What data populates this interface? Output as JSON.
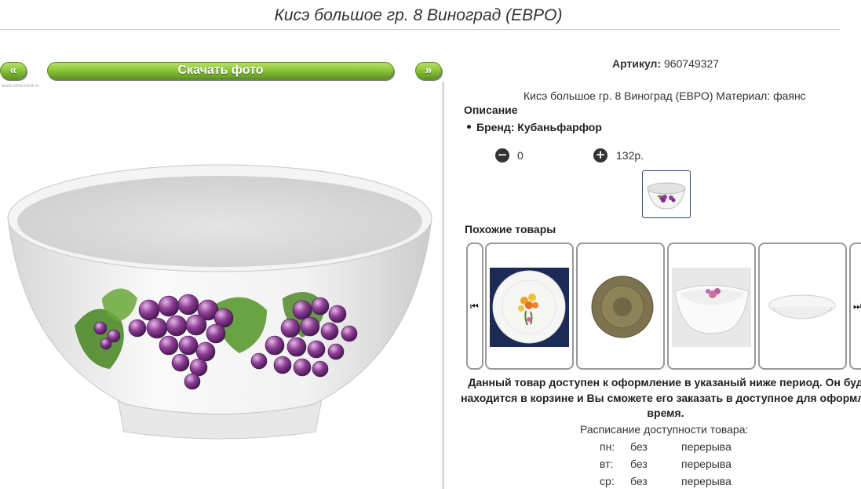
{
  "product": {
    "title": "Кисэ большое гр. 8 Виноград (ЕВРО)",
    "article_label": "Артикул:",
    "article_value": "960749327",
    "description": "Кисэ большое гр. 8 Виноград (ЕВРО) Материал: фаянс",
    "description_heading": "Описание",
    "brand": "Бренд: Кубаньфарфор",
    "quantity": "0",
    "price": "132р.",
    "watermark": "www.sima-land.ru"
  },
  "toolbar": {
    "prev_label": "«",
    "download_label": "Скачать фото",
    "next_label": "»"
  },
  "similar": {
    "heading": "Похожие товары",
    "prev_icon": "⏮",
    "next_icon": "⏭",
    "items": [
      "plate-flowers",
      "brown-glass-plate",
      "square-bowl-rose",
      "white-shallow-bowl"
    ]
  },
  "notice": {
    "line1": "Данный товар доступен к оформление в указаный ниже период. Он буд",
    "line2": "находится в корзине и Вы сможете его заказать в доступное для оформле",
    "line3": "время."
  },
  "schedule": {
    "title": "Расписание доступности товара:",
    "rows": [
      {
        "day": "пн:",
        "a": "без",
        "b": "перерыва"
      },
      {
        "day": "вт:",
        "a": "без",
        "b": "перерыва"
      },
      {
        "day": "ср:",
        "a": "без",
        "b": "перерыва"
      }
    ]
  },
  "colors": {
    "green_top": "#b8e060",
    "green_bottom": "#5f9a1e",
    "border_blue": "#2a4a78"
  }
}
